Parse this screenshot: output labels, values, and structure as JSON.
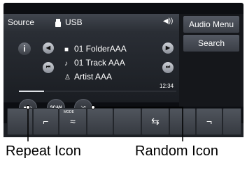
{
  "header": {
    "source_label": "Source",
    "usb_label": "USB",
    "volume_icon": "volume-icon"
  },
  "right_menu": {
    "audio_menu_label": "Audio Menu",
    "search_label": "Search"
  },
  "now_playing": {
    "folder": "01 FolderAAA",
    "track": "01 Track AAA",
    "artist": "Artist AAA",
    "time": "12:34",
    "progress_fraction": 0.16
  },
  "controls": {
    "info_label": "i",
    "scan_label": "SCAN"
  },
  "bottom_bar": {
    "mode_label": "MODE"
  },
  "callouts": {
    "repeat": "Repeat Icon",
    "random": "Random Icon"
  }
}
